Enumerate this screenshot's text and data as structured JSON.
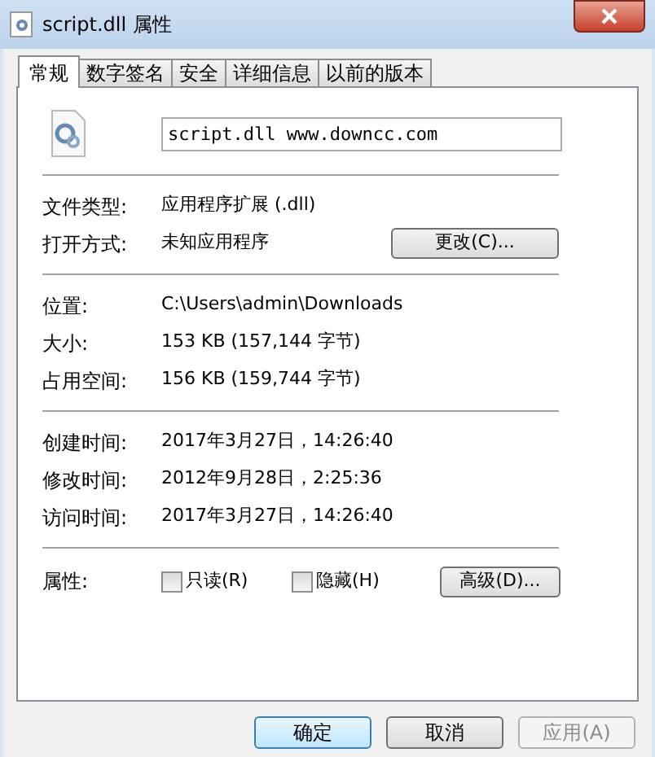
{
  "window": {
    "title": "script.dll 属性"
  },
  "tabs": [
    {
      "label": "常规",
      "selected": true
    },
    {
      "label": "数字签名",
      "selected": false
    },
    {
      "label": "安全",
      "selected": false
    },
    {
      "label": "详细信息",
      "selected": false
    },
    {
      "label": "以前的版本",
      "selected": false
    }
  ],
  "file_name": {
    "value": "script.dll www.downcc.com"
  },
  "groups": [
    [
      {
        "label": "文件类型:",
        "value": "应用程序扩展 (.dll)"
      },
      {
        "label": "打开方式:",
        "value": "未知应用程序",
        "button": "更改(C)..."
      }
    ],
    [
      {
        "label": "位置:",
        "value": "C:\\Users\\admin\\Downloads"
      },
      {
        "label": "大小:",
        "value": "153 KB (157,144 字节)"
      },
      {
        "label": "占用空间:",
        "value": "156 KB (159,744 字节)"
      }
    ],
    [
      {
        "label": "创建时间:",
        "value": "2017年3月27日，14:26:40"
      },
      {
        "label": "修改时间:",
        "value": "2012年9月28日，2:25:36"
      },
      {
        "label": "访问时间:",
        "value": "2017年3月27日，14:26:40"
      }
    ]
  ],
  "attributes": {
    "label": "属性:",
    "checkboxes": [
      {
        "label": "只读(R)",
        "checked": false
      },
      {
        "label": "隐藏(H)",
        "checked": false
      }
    ],
    "button": "高级(D)..."
  },
  "buttons": [
    {
      "label": "确定",
      "disabled": false,
      "default": true
    },
    {
      "label": "取消",
      "disabled": false,
      "default": false
    },
    {
      "label": "应用(A)",
      "disabled": true,
      "default": false
    }
  ]
}
